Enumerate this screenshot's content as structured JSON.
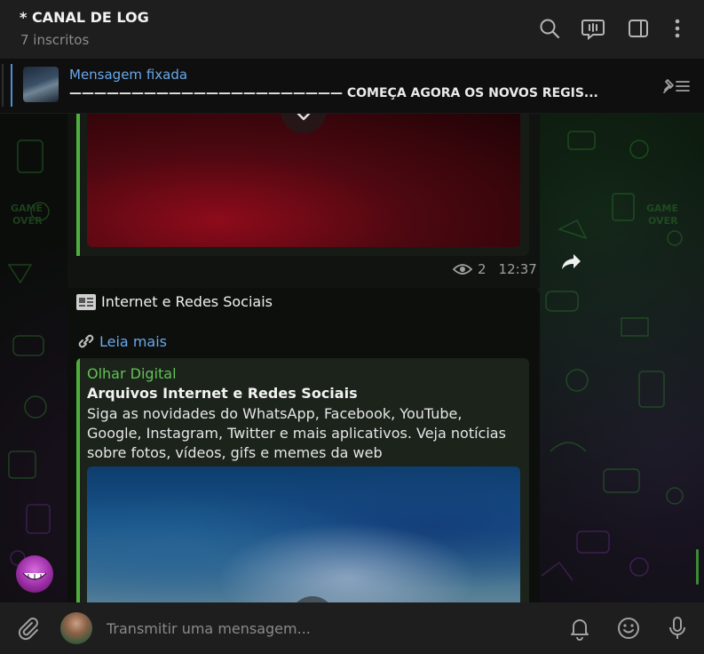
{
  "header": {
    "title": "* CANAL DE LOG",
    "subscribers": "7 inscritos"
  },
  "pinned": {
    "label": "Mensagem fixada",
    "text": "—————————————————————— COMEÇA AGORA OS NOVOS REGIS..."
  },
  "message1": {
    "views": "2",
    "time": "12:37"
  },
  "message2": {
    "heading": "Internet e Redes Sociais",
    "link": "Leia mais",
    "preview": {
      "site": "Olhar Digital",
      "title": "Arquivos Internet e Redes Sociais",
      "description": "Siga as novidades do WhatsApp, Facebook, YouTube, Google, Instagram, Twitter e mais aplicativos. Veja notícias sobre fotos, vídeos, gifs e memes da web"
    }
  },
  "input": {
    "placeholder": "Transmitir uma mensagem..."
  },
  "colors": {
    "accent_blue": "#6aa8ea",
    "accent_green": "#4faf3d",
    "header_bg": "#1e1e1e"
  },
  "icons": {
    "header": [
      "search-icon",
      "live-stream-icon",
      "sidebar-toggle-icon",
      "more-vertical-icon"
    ],
    "pinned": "pin-list-icon",
    "input": [
      "paperclip-icon",
      "bell-icon",
      "emoji-icon",
      "microphone-icon"
    ]
  }
}
